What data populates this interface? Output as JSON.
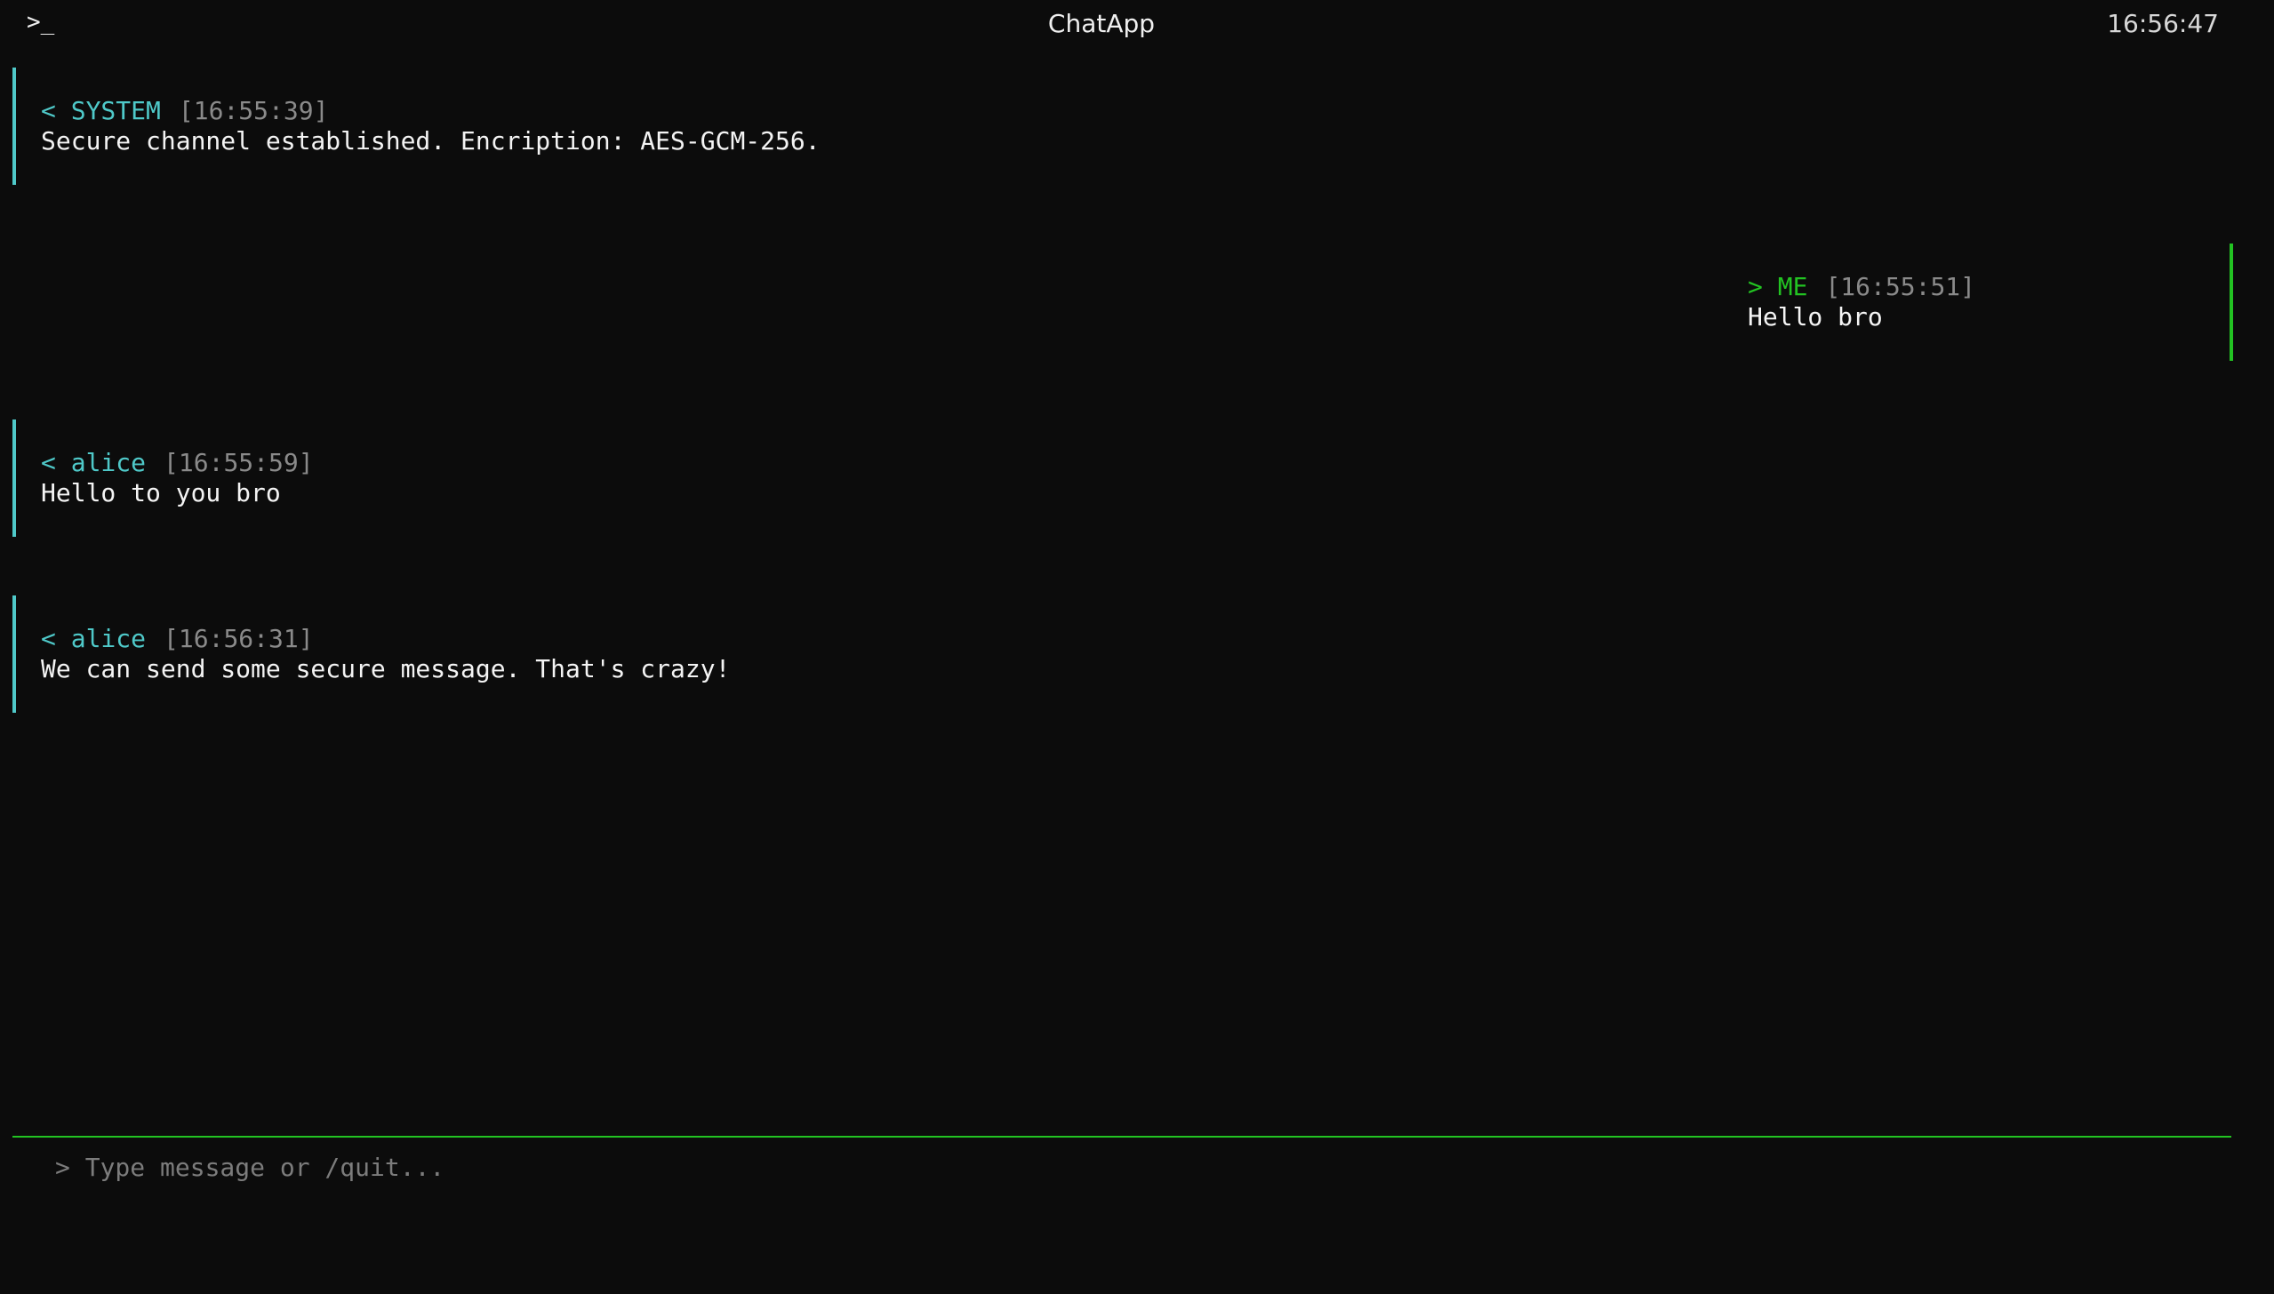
{
  "header": {
    "prompt_icon": ">_",
    "title": "ChatApp",
    "clock": "16:56:47"
  },
  "messages": [
    {
      "direction": "incoming",
      "arrow": "<",
      "sender": "SYSTEM",
      "time": "[16:55:39]",
      "text": "Secure channel established. Encription: AES-GCM-256."
    },
    {
      "direction": "outgoing",
      "arrow": ">",
      "sender": "ME",
      "time": "[16:55:51]",
      "text": "Hello bro"
    },
    {
      "direction": "incoming",
      "arrow": "<",
      "sender": "alice",
      "time": "[16:55:59]",
      "text": "Hello to you bro"
    },
    {
      "direction": "incoming",
      "arrow": "<",
      "sender": "alice",
      "time": "[16:56:31]",
      "text": "We can send some secure message. That's crazy!"
    }
  ],
  "composer": {
    "placeholder": "> Type message or /quit...",
    "value": ""
  },
  "colors": {
    "background": "#0c0c0c",
    "incoming_accent": "#4fc9c9",
    "outgoing_accent": "#22c322",
    "timestamp": "#8a8a8a",
    "placeholder": "#7c7c7c"
  }
}
